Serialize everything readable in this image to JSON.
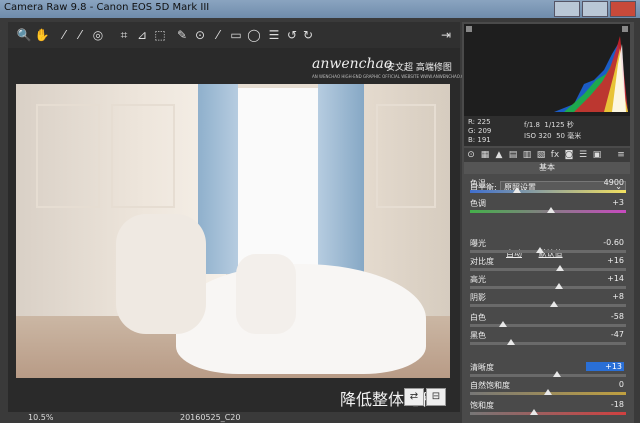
{
  "window": {
    "title": "Camera Raw 9.8 - Canon EOS 5D Mark III"
  },
  "toolbar": {
    "tools": [
      {
        "name": "zoom-icon",
        "glyph": "🔍"
      },
      {
        "name": "hand-icon",
        "glyph": "✋"
      },
      {
        "name": "white-balance-icon",
        "glyph": "⁄"
      },
      {
        "name": "color-sampler-icon",
        "glyph": "⁄"
      },
      {
        "name": "targeted-adjust-icon",
        "glyph": "◎"
      },
      {
        "name": "crop-icon",
        "glyph": "⌗"
      },
      {
        "name": "straighten-icon",
        "glyph": "⊿"
      },
      {
        "name": "transform-icon",
        "glyph": "⬚"
      },
      {
        "name": "spot-removal-icon",
        "glyph": "✎"
      },
      {
        "name": "red-eye-icon",
        "glyph": "⊙"
      },
      {
        "name": "adjustment-brush-icon",
        "glyph": "⁄"
      },
      {
        "name": "graduated-filter-icon",
        "glyph": "▭"
      },
      {
        "name": "radial-filter-icon",
        "glyph": "◯"
      },
      {
        "name": "preferences-icon",
        "glyph": "☰"
      },
      {
        "name": "rotate-left-icon",
        "glyph": "↺"
      },
      {
        "name": "rotate-right-icon",
        "glyph": "↻"
      }
    ],
    "export_glyph": "⇥"
  },
  "watermark": {
    "brand": "anwenchao",
    "cn": "安文超 高端修图",
    "sub": "AN WENCHAO HIGH-END GRAPHIC OFFICIAL WEBSITE WWW.ANWENCHAO.COM"
  },
  "caption": "降低整体饱和",
  "status": {
    "zoom": "10.5%",
    "filename": "20160525_C20"
  },
  "info": {
    "r": "R: 225",
    "g": "G: 209",
    "b": "B: 191",
    "aperture": "f/1.8",
    "shutter": "1/125 秒",
    "iso": "ISO 320",
    "focal": "50 毫米"
  },
  "panel": {
    "section_title": "基本",
    "wb_label": "白平衡:",
    "wb_value": "原照设置",
    "auto": "自动",
    "default": "默认值",
    "sliders": [
      {
        "label": "色温",
        "value": "4900",
        "pos": 0.3
      },
      {
        "label": "色调",
        "value": "+3",
        "pos": 0.52
      },
      {
        "label": "曝光",
        "value": "-0.60",
        "pos": 0.45
      },
      {
        "label": "对比度",
        "value": "+16",
        "pos": 0.58
      },
      {
        "label": "高光",
        "value": "+14",
        "pos": 0.57
      },
      {
        "label": "阴影",
        "value": "+8",
        "pos": 0.54
      },
      {
        "label": "白色",
        "value": "-58",
        "pos": 0.21
      },
      {
        "label": "黑色",
        "value": "-47",
        "pos": 0.26
      },
      {
        "label": "清晰度",
        "value": "+13",
        "pos": 0.56,
        "highlight": true
      },
      {
        "label": "自然饱和度",
        "value": "0",
        "pos": 0.5
      },
      {
        "label": "饱和度",
        "value": "-18",
        "pos": 0.41
      }
    ]
  },
  "colors": {
    "accent": "#2a6fd6",
    "panel_bg": "#4a4a4a",
    "hist_bg": "#1e1e1e"
  }
}
